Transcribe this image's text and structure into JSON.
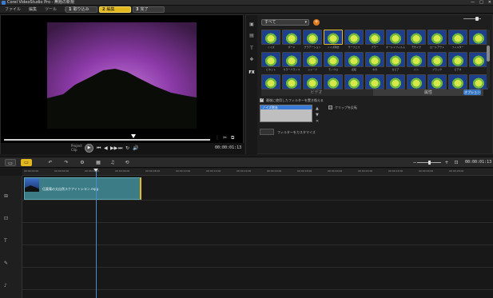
{
  "window": {
    "title": "Corel VideoStudio Pro - 無題の新規",
    "controls": [
      "—",
      "□",
      "✕"
    ]
  },
  "menu": [
    "ファイル",
    "編集",
    "ツール",
    "設定"
  ],
  "steps": [
    {
      "num": "1",
      "label": "取り込み"
    },
    {
      "num": "2",
      "label": "編集"
    },
    {
      "num": "3",
      "label": "完了"
    }
  ],
  "player": {
    "mode_label_top": "Project",
    "mode_label_bottom": "Clip",
    "timecode": "00:00:01:13",
    "controls": [
      "⏮",
      "◀",
      "▶▶",
      "⏭",
      "↻",
      "🔊"
    ]
  },
  "library": {
    "dropdown_value": "すべて",
    "add_icon": "+",
    "thumb_labels": [
      "ノイズ",
      "ボード",
      "グラデーション",
      "ノイズ除去",
      "サーフェス",
      "ブラー",
      "オールドフィルム",
      "モザイク",
      "ロールアウト",
      "フィルター",
      "",
      "ビネット",
      "カラーバランス",
      "シャープ",
      "モノクロ",
      "反転",
      "ネガ",
      "セピア",
      "パン",
      "ブラック",
      "ビデオ",
      "",
      "",
      "",
      "",
      "",
      "",
      "",
      "",
      "",
      "",
      "",
      ""
    ],
    "sub_tabs": [
      "ビデオ",
      "属性"
    ],
    "options_button": "オプション",
    "attr": {
      "replace_label": "最後に使用したフィルターを置き換える",
      "listbox_header": "ノイズ除去",
      "clip_sync_label": "クリップを反転",
      "custom_label": "フィルターをカスタマイズ"
    }
  },
  "timeline": {
    "timecode": "00:00:01:13",
    "ruler": [
      "00:00:00:00",
      "00:00:02:00",
      "00:00:04:00",
      "00:00:06:00",
      "00:00:08:00",
      "00:00:10:00",
      "00:00:12:00",
      "00:00:14:00",
      "00:00:16:00",
      "00:00:18:00",
      "00:00:20:00",
      "00:00:22:00",
      "00:00:24:00",
      "00:00:26:00",
      "00:00:28:00"
    ],
    "clip_label": "伍薬薙の太自然スケアイトシヨン.mpg",
    "track_icons": [
      "video-track-icon",
      "overlay-track-icon",
      "title-track-icon",
      "voice-track-icon",
      "music-track-icon"
    ]
  },
  "colors": {
    "accent": "#e3b91f",
    "clip": "#3b7c86",
    "playhead": "#4a8ad0"
  }
}
